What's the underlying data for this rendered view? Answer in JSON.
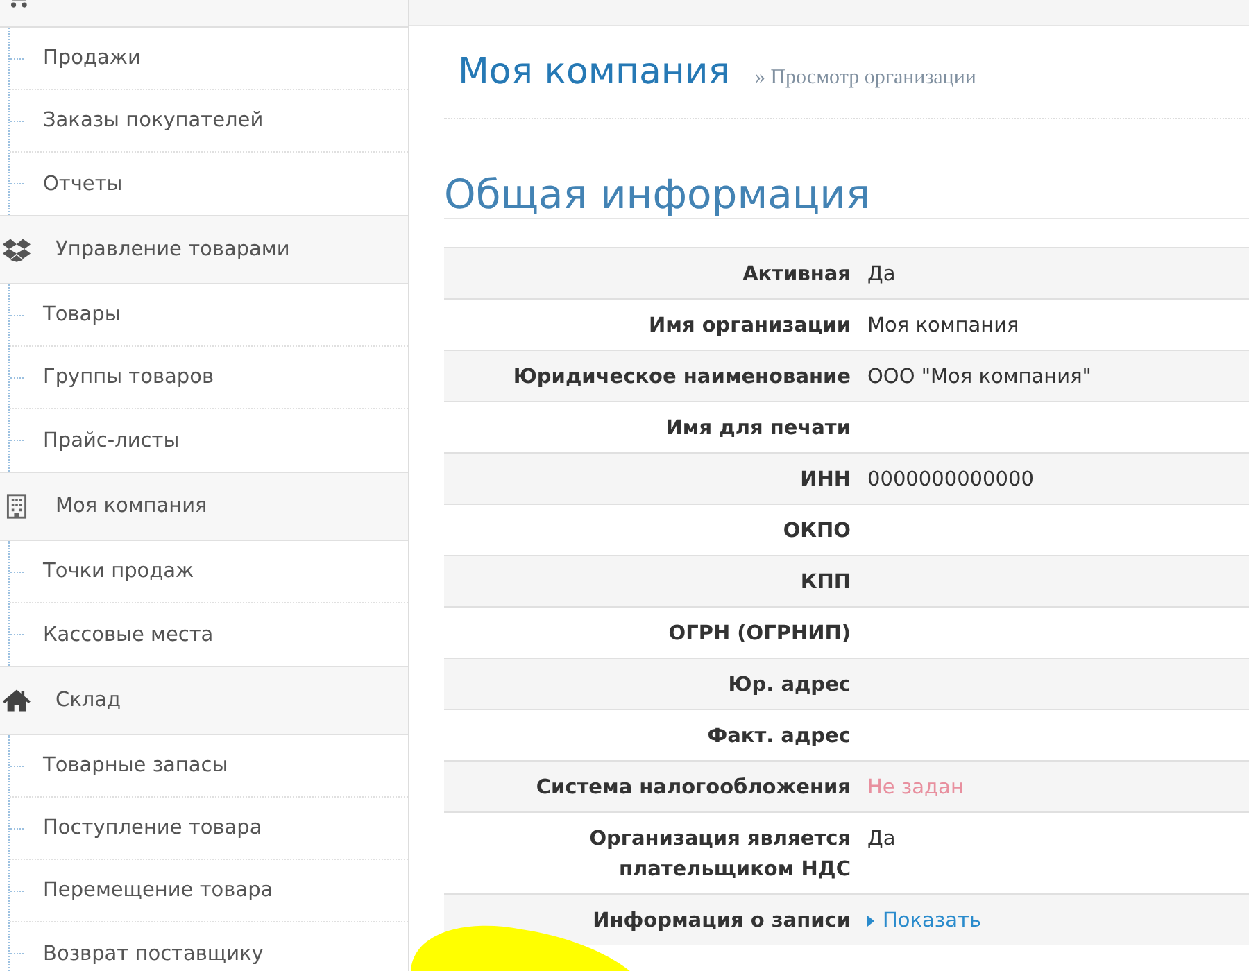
{
  "sidebar": {
    "groups": [
      {
        "children": [
          "Продажи",
          "Заказы покупателей",
          "Отчеты"
        ]
      },
      {
        "label": "Управление товарами",
        "children": [
          "Товары",
          "Группы товаров",
          "Прайс-листы"
        ]
      },
      {
        "label": "Моя компания",
        "children": [
          "Точки продаж",
          "Кассовые места"
        ]
      },
      {
        "label": "Склад",
        "children": [
          "Товарные запасы",
          "Поступление товара",
          "Перемещение товара",
          "Возврат поставщику"
        ]
      }
    ]
  },
  "page": {
    "title": "Моя компания",
    "subtitle": "» Просмотр организации"
  },
  "section": {
    "title": "Общая информация"
  },
  "rows": [
    {
      "label": "Активная",
      "value": "Да",
      "kind": "text"
    },
    {
      "label": "Имя организации",
      "value": "Моя компания",
      "kind": "text"
    },
    {
      "label": "Юридическое наименование",
      "value": "ООО \"Моя компания\"",
      "kind": "text"
    },
    {
      "label": "Имя для печати"
    },
    {
      "label": "ИНН",
      "value": "0000000000000",
      "kind": "text"
    },
    {
      "label": "ОКПО"
    },
    {
      "label": "КПП"
    },
    {
      "label": "ОГРН (ОГРНИП)"
    },
    {
      "label": "Юр. адрес"
    },
    {
      "label": "Факт. адрес"
    },
    {
      "label": "Система налогообложения",
      "value": "Не задан",
      "kind": "unset"
    },
    {
      "label": "Организация является плательщиком НДС",
      "value": "Да",
      "kind": "text"
    },
    {
      "label": "Информация о записи",
      "value": "Показать",
      "kind": "link"
    }
  ]
}
